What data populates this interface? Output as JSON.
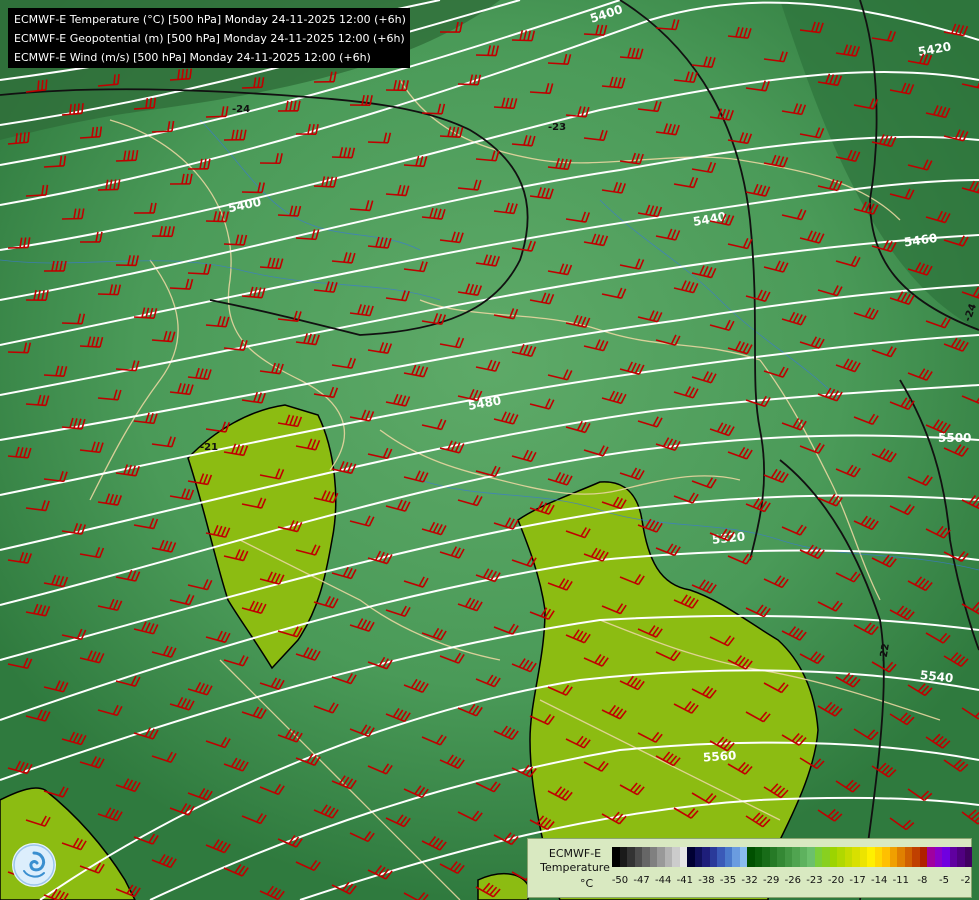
{
  "title_lines": [
    "ECMWF-E Temperature (°C) [500 hPa] Monday 24-11-2025 12:00 (+6h)",
    "ECMWF-E Geopotential (m) [500 hPa] Monday 24-11-2025 12:00 (+6h)",
    "ECMWF-E Wind (m/s) [500 hPa] Monday 24-11-2025 12:00 (+6h)"
  ],
  "legend": {
    "title_line1": "ECMWF-E",
    "title_line2": "Temperature",
    "unit": "°C",
    "ticks": [
      "-50",
      "-47",
      "-44",
      "-41",
      "-38",
      "-35",
      "-32",
      "-29",
      "-26",
      "-23",
      "-20",
      "-17",
      "-14",
      "-11",
      "-8",
      "-5",
      "-2"
    ],
    "colors": [
      "#000000",
      "#1a1a1a",
      "#333333",
      "#4d4d4d",
      "#666666",
      "#808080",
      "#999999",
      "#b3b3b3",
      "#cccccc",
      "#e6e6e6",
      "#000033",
      "#10105a",
      "#1e1e7a",
      "#2a3a9a",
      "#3a5ab8",
      "#4a7acc",
      "#6a9ce0",
      "#8abcf0",
      "#005000",
      "#0a5e0a",
      "#186c18",
      "#267a26",
      "#348834",
      "#429642",
      "#50a450",
      "#5eb25e",
      "#6cc06c",
      "#7ace3a",
      "#88d020",
      "#9cd400",
      "#b0d800",
      "#c4dc00",
      "#d8e000",
      "#ece400",
      "#fff000",
      "#ffd800",
      "#ffc000",
      "#f0a000",
      "#e08000",
      "#d06000",
      "#c04000",
      "#b02000",
      "#a000a0",
      "#8a00c8",
      "#7000e0",
      "#6000a0",
      "#500080",
      "#400060"
    ]
  },
  "contour_labels": {
    "geopotential": [
      "5400",
      "5440",
      "5460",
      "5480",
      "5500",
      "5520",
      "5540",
      "5560",
      "5420",
      "5400"
    ],
    "temperature": [
      "-24",
      "-23",
      "-22",
      "-21",
      "-24"
    ]
  },
  "colors": {
    "background": "#3f8a4e",
    "warm_patch": "#8cbc12",
    "barb": "#c00000",
    "isohypse": "#ffffff",
    "isotherm": "#000000",
    "border": "#e8d6a0",
    "river": "#3a78d8"
  },
  "icons": {
    "logo": "ecmwf-logo-icon"
  }
}
